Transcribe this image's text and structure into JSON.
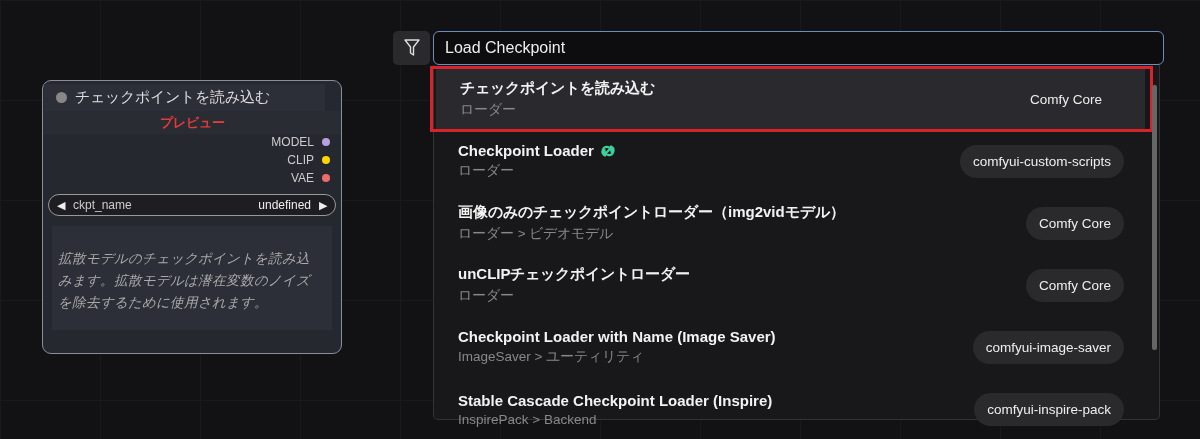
{
  "node": {
    "title": "チェックポイントを読み込む",
    "preview": "プレビュー",
    "outputs": [
      {
        "label": "MODEL",
        "color": "#b7a2e0"
      },
      {
        "label": "CLIP",
        "color": "#ffd500"
      },
      {
        "label": "VAE",
        "color": "#f06a6a"
      }
    ],
    "widget": {
      "name": "ckpt_name",
      "value": "undefined",
      "prev": "◀",
      "next": "▶"
    },
    "description": "拡散モデルのチェックポイントを読み込みます。拡散モデルは潜在変数のノイズを除去するために使用されます。"
  },
  "search": {
    "value": "Load Checkpoint"
  },
  "results": [
    {
      "title": "チェックポイントを読み込む",
      "category": "ローダー",
      "source": "Comfy Core",
      "selected": true,
      "has_icon": false,
      "highlighted": true
    },
    {
      "title": "Checkpoint Loader",
      "category": "ローダー",
      "source": "comfyui-custom-scripts",
      "selected": false,
      "has_icon": true,
      "highlighted": false
    },
    {
      "title": "画像のみのチェックポイントローダー（img2vidモデル）",
      "category": "ローダー > ビデオモデル",
      "source": "Comfy Core",
      "selected": false,
      "has_icon": false,
      "highlighted": false
    },
    {
      "title": "unCLIPチェックポイントローダー",
      "category": "ローダー",
      "source": "Comfy Core",
      "selected": false,
      "has_icon": false,
      "highlighted": false
    },
    {
      "title": "Checkpoint Loader with Name (Image Saver)",
      "category": "ImageSaver > ユーティリティ",
      "source": "comfyui-image-saver",
      "selected": false,
      "has_icon": false,
      "highlighted": false
    },
    {
      "title": "Stable Cascade Checkpoint Loader (Inspire)",
      "category": "InspirePack > Backend",
      "source": "comfyui-inspire-pack",
      "selected": false,
      "has_icon": false,
      "highlighted": false
    }
  ]
}
